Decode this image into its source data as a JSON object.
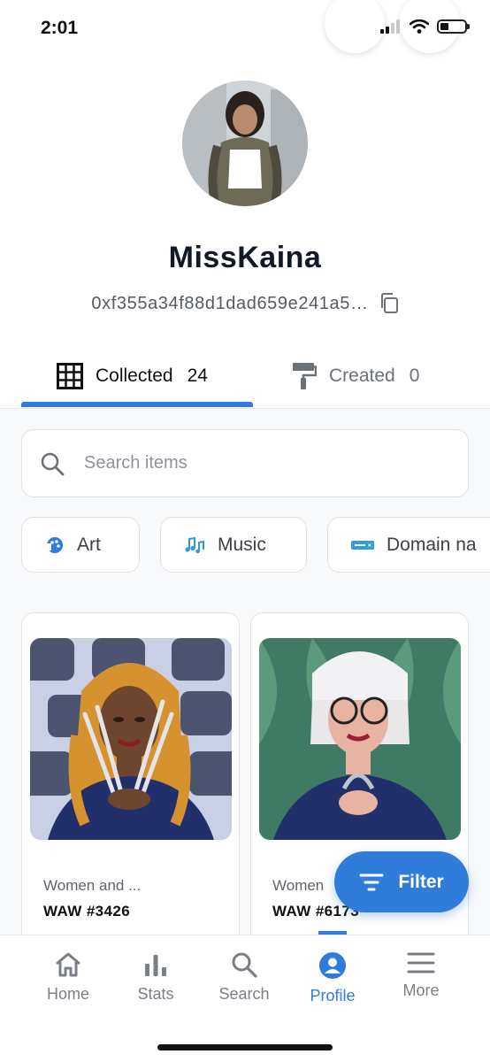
{
  "status_bar": {
    "time": "2:01"
  },
  "profile": {
    "username": "MissKaina",
    "address": "0xf355a34f88d1dad659e241a5…"
  },
  "tabs": [
    {
      "label": "Collected",
      "count": "24",
      "active": true
    },
    {
      "label": "Created",
      "count": "0",
      "active": false
    }
  ],
  "search": {
    "placeholder": "Search items"
  },
  "categories": [
    {
      "label": "Art",
      "icon": "art-palette-icon"
    },
    {
      "label": "Music",
      "icon": "music-note-icon"
    },
    {
      "label": "Domain na",
      "icon": "domain-icon"
    }
  ],
  "items": [
    {
      "collection": "Women and ...",
      "name": "WAW #3426"
    },
    {
      "collection": "Women",
      "name": "WAW #6173"
    }
  ],
  "filter_button": {
    "label": "Filter"
  },
  "bottom_nav": [
    {
      "label": "Home",
      "icon": "home-icon"
    },
    {
      "label": "Stats",
      "icon": "bar-chart-icon"
    },
    {
      "label": "Search",
      "icon": "search-icon"
    },
    {
      "label": "Profile",
      "icon": "profile-icon",
      "active": true
    },
    {
      "label": "More",
      "icon": "menu-icon"
    }
  ],
  "colors": {
    "accent": "#2f7cdb",
    "text": "#111827",
    "muted": "#7a7f87"
  }
}
